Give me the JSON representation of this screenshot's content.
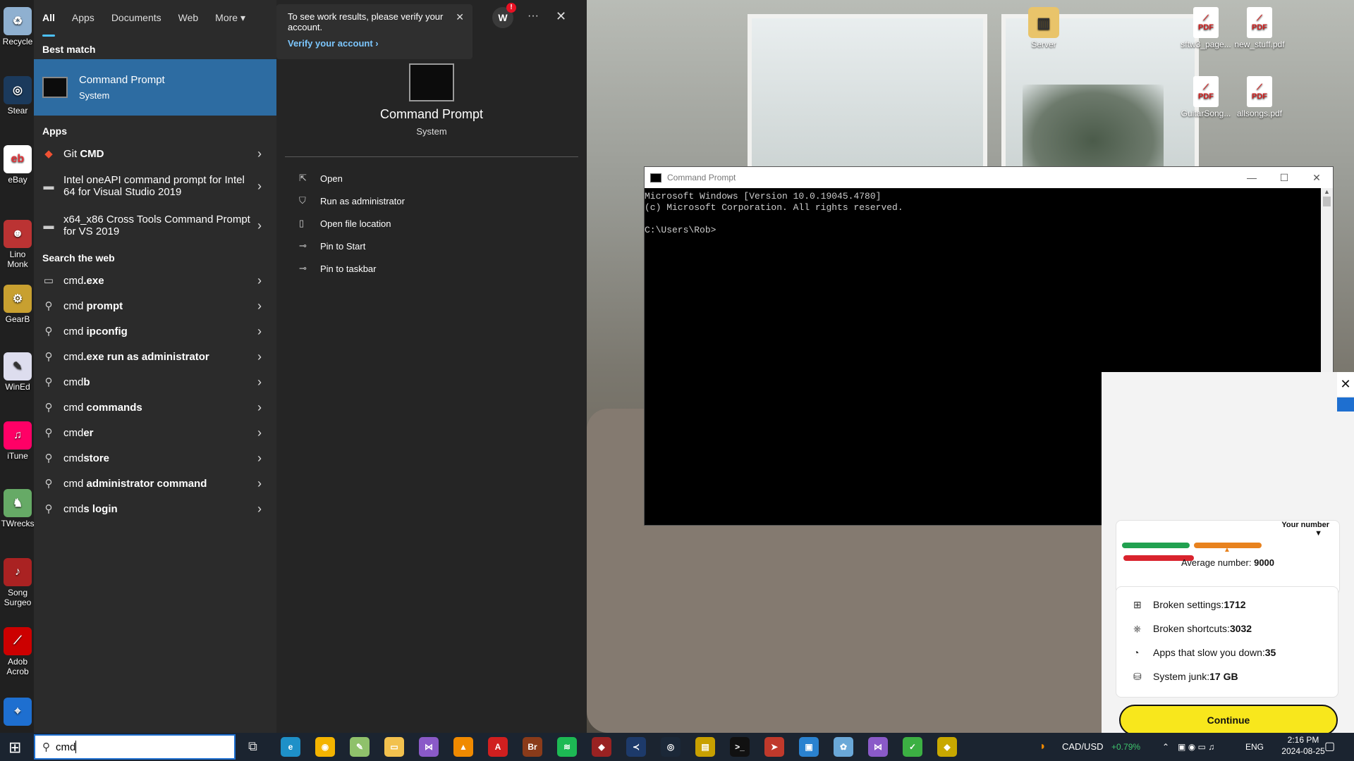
{
  "desktop": {
    "left_icons": [
      {
        "label": "Recycle",
        "icon": "recycle-bin-icon",
        "color": "#8fb0d0"
      },
      {
        "label": "Stear",
        "icon": "steam-icon",
        "color": "#1b3a5c"
      },
      {
        "label": "eBay",
        "icon": "ebay-icon",
        "color": "#ffffff"
      },
      {
        "label": "Lino Monk",
        "icon": "app-icon",
        "color": "#b33"
      },
      {
        "label": "GearB",
        "icon": "gear-icon",
        "color": "#c8a030"
      },
      {
        "label": "WinEd",
        "icon": "document-icon",
        "color": "#dde"
      },
      {
        "label": "iTune",
        "icon": "music-icon",
        "color": "#f06"
      },
      {
        "label": "TWrecks",
        "icon": "dinosaur-icon",
        "color": "#6a6"
      },
      {
        "label": "Song Surgeo",
        "icon": "song-surgeon-icon",
        "color": "#a22"
      },
      {
        "label": "Adob Acrob",
        "icon": "pdf-icon",
        "color": "#c00"
      }
    ],
    "right_icons": [
      {
        "label": "Server",
        "icon": "folder-icon"
      },
      {
        "label": "sftw3_page...",
        "icon": "pdf-file-icon"
      },
      {
        "label": "new_stuff.pdf",
        "icon": "pdf-file-icon"
      },
      {
        "label": "GuitarSong...",
        "icon": "pdf-file-icon"
      },
      {
        "label": "allsongs.pdf",
        "icon": "pdf-file-icon"
      }
    ],
    "pdf_badge": "PDF"
  },
  "search_panel": {
    "tabs": [
      "All",
      "Apps",
      "Documents",
      "Web",
      "More"
    ],
    "avatar_initial": "W",
    "avatar_alert": "!",
    "more_options": "···",
    "close": "✕",
    "notification": {
      "text": "To see work results, please verify your account.",
      "link": "Verify your account",
      "close": "✕"
    },
    "best_match_heading": "Best match",
    "best_match": {
      "title": "Command Prompt",
      "subtitle": "System"
    },
    "apps_heading": "Apps",
    "apps": [
      {
        "label_plain": "Git ",
        "label_bold": "CMD"
      },
      {
        "label_plain": "Intel oneAPI command prompt for Intel 64 for Visual Studio 2019",
        "label_bold": ""
      },
      {
        "label_plain": "x64_x86 Cross Tools Command Prompt for VS 2019",
        "label_bold": ""
      }
    ],
    "web_heading": "Search the web",
    "web_results": [
      {
        "plain": "cmd",
        "bold": ".exe"
      },
      {
        "plain": "cmd ",
        "bold": "prompt"
      },
      {
        "plain": "cmd ",
        "bold": "ipconfig"
      },
      {
        "plain": "cmd",
        "bold": ".exe run as administrator"
      },
      {
        "plain": "cmd",
        "bold": "b"
      },
      {
        "plain": "cmd ",
        "bold": "commands"
      },
      {
        "plain": "cmd",
        "bold": "er"
      },
      {
        "plain": "cmd",
        "bold": "store"
      },
      {
        "plain": "cmd ",
        "bold": "administrator command"
      },
      {
        "plain": "cmd",
        "bold": "s login"
      }
    ],
    "preview": {
      "title": "Command Prompt",
      "subtitle": "System",
      "actions": [
        "Open",
        "Run as administrator",
        "Open file location",
        "Pin to Start",
        "Pin to taskbar"
      ]
    },
    "query": "cmd"
  },
  "cmd_window": {
    "title": "Command Prompt",
    "minimize": "—",
    "maximize": "☐",
    "close": "✕",
    "lines": [
      "Microsoft Windows [Version 10.0.19045.4780]",
      "(c) Microsoft Corporation. All rights reserved.",
      "",
      "C:\\Users\\Rob>"
    ]
  },
  "cleaner": {
    "close": "✕",
    "your_number": "Your number",
    "average_label": "Average number: ",
    "average_value": "9000",
    "bar_colors": [
      "#21a150",
      "#e8821e",
      "#d9232d"
    ],
    "stats": [
      {
        "label": "Broken settings: ",
        "value": "1712",
        "icon": "settings-grid-icon"
      },
      {
        "label": "Broken shortcuts: ",
        "value": "3032",
        "icon": "shortcut-icon"
      },
      {
        "label": "Apps that slow you down: ",
        "value": "35",
        "icon": "speedometer-icon"
      },
      {
        "label": "System junk: ",
        "value": "17 GB",
        "icon": "junk-icon"
      }
    ],
    "continue": "Continue"
  },
  "taskbar": {
    "start": "⊞",
    "task_view": "⧉",
    "apps": [
      {
        "name": "edge-icon",
        "color": "#1e90c8",
        "glyph": "e"
      },
      {
        "name": "chrome-icon",
        "color": "#f4b400",
        "glyph": "◉"
      },
      {
        "name": "notepad-plus-icon",
        "color": "#8fc16b",
        "glyph": "✎"
      },
      {
        "name": "file-explorer-icon",
        "color": "#f2c14e",
        "glyph": "▭"
      },
      {
        "name": "visual-studio-icon",
        "color": "#8a5ac8",
        "glyph": "⋈"
      },
      {
        "name": "vlc-icon",
        "color": "#f08a00",
        "glyph": "▲"
      },
      {
        "name": "acrobat-icon",
        "color": "#d01f1f",
        "glyph": "A"
      },
      {
        "name": "bridge-icon",
        "color": "#8a3b1a",
        "glyph": "Br"
      },
      {
        "name": "spotify-icon",
        "color": "#1db954",
        "glyph": "≋"
      },
      {
        "name": "game-icon",
        "color": "#992222",
        "glyph": "◆"
      },
      {
        "name": "vs-code-icon",
        "color": "#1d3a6a",
        "glyph": "≺"
      },
      {
        "name": "steam-taskbar-icon",
        "color": "#1b2838",
        "glyph": "◎"
      },
      {
        "name": "winrar-icon",
        "color": "#c8a000",
        "glyph": "▤"
      },
      {
        "name": "terminal-icon",
        "color": "#111111",
        "glyph": ">_"
      },
      {
        "name": "pointer-app-icon",
        "color": "#c0392b",
        "glyph": "➤"
      },
      {
        "name": "photos-icon",
        "color": "#2a82d0",
        "glyph": "▣"
      },
      {
        "name": "paint-icon",
        "color": "#6aa8d8",
        "glyph": "✿"
      },
      {
        "name": "visual-studio-2-icon",
        "color": "#8a5ac8",
        "glyph": "⋈"
      },
      {
        "name": "check-app-icon",
        "color": "#3cb043",
        "glyph": "✓"
      },
      {
        "name": "git-gui-icon",
        "color": "#c8a800",
        "glyph": "◆"
      }
    ],
    "ticker_label": "CAD/USD",
    "ticker_change": "+0.79%",
    "lang": "ENG",
    "time": "2:16 PM",
    "date": "2024-08-25"
  }
}
